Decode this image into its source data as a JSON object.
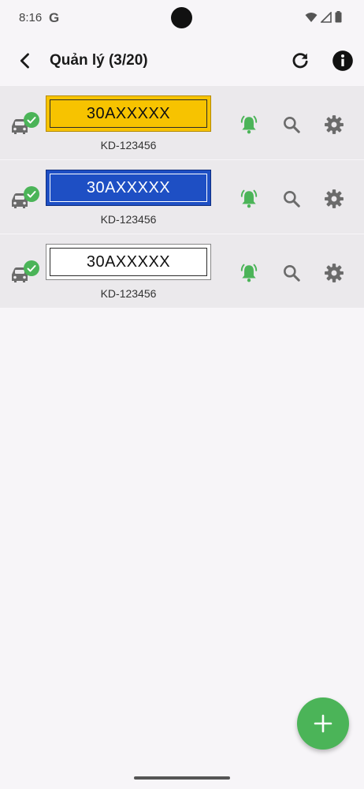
{
  "status": {
    "time": "8:16"
  },
  "header": {
    "title": "Quản lý (3/20)"
  },
  "vehicles": [
    {
      "plate": "30AXXXXX",
      "code": "KD-123456",
      "plate_color": "yellow"
    },
    {
      "plate": "30AXXXXX",
      "code": "KD-123456",
      "plate_color": "blue"
    },
    {
      "plate": "30AXXXXX",
      "code": "KD-123456",
      "plate_color": "white"
    }
  ],
  "colors": {
    "accent_green": "#4bb458",
    "plate_yellow": "#f7c300",
    "plate_blue": "#1e4fc4",
    "row_bg": "#ebe9ec",
    "page_bg": "#f7f5f8"
  },
  "icons": [
    "back-arrow-icon",
    "refresh-icon",
    "info-icon",
    "car-icon",
    "check-circle-icon",
    "bell-ring-icon",
    "search-icon",
    "gear-icon",
    "plus-icon"
  ]
}
